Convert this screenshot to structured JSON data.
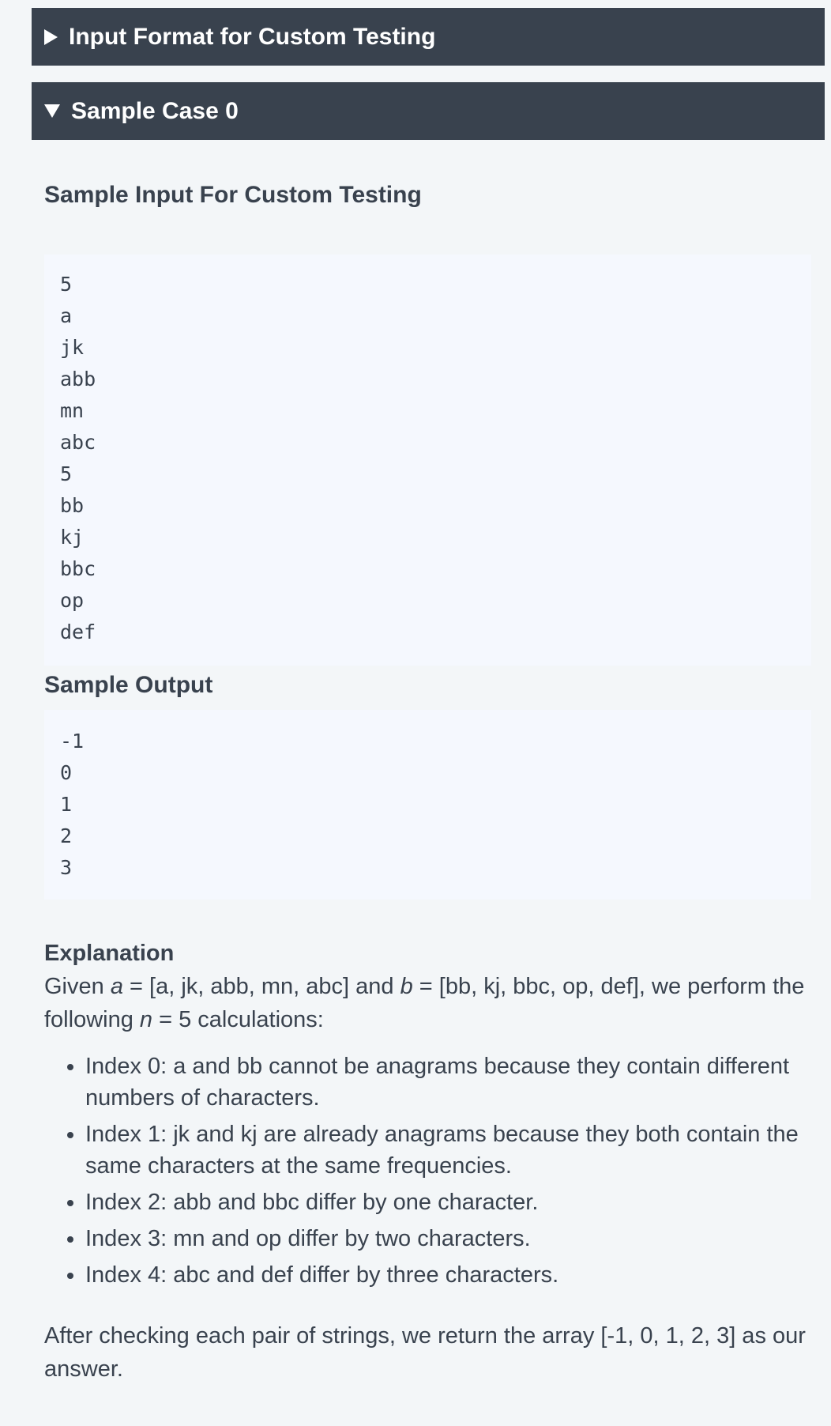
{
  "sections": {
    "input_format_label": "Input Format for Custom Testing",
    "sample_case_label": "Sample Case 0"
  },
  "sample_input": {
    "heading": "Sample Input For Custom Testing",
    "lines": [
      "5",
      "a",
      "jk",
      "abb",
      "mn",
      "abc",
      "5",
      "bb",
      "kj",
      "bbc",
      "op",
      "def"
    ]
  },
  "sample_output": {
    "heading": "Sample Output",
    "lines": [
      "-1",
      "0",
      "1",
      "2",
      "3"
    ]
  },
  "explanation": {
    "title": "Explanation",
    "intro_1": "Given ",
    "var_a": "a",
    "intro_2": " = [a, jk, abb, mn, abc] and ",
    "var_b": "b",
    "intro_3": " = [bb, kj, bbc, op, def], we perform the following ",
    "var_n": "n",
    "intro_4": " = 5 calculations:",
    "bullets": [
      "Index 0: a and bb cannot be anagrams because they contain different numbers of characters.",
      "Index 1: jk and kj are already anagrams because they both contain the same characters at the same frequencies.",
      "Index 2: abb and bbc differ by one character.",
      "Index 3: mn and op differ by two characters.",
      "Index 4: abc and def differ by three characters."
    ],
    "closing": "After checking each pair of strings, we return the array [-1, 0, 1, 2, 3] as our answer."
  },
  "colors": {
    "bar_bg": "#39424e",
    "page_bg": "#f3f6f8",
    "code_bg": "#f5f8fe"
  }
}
